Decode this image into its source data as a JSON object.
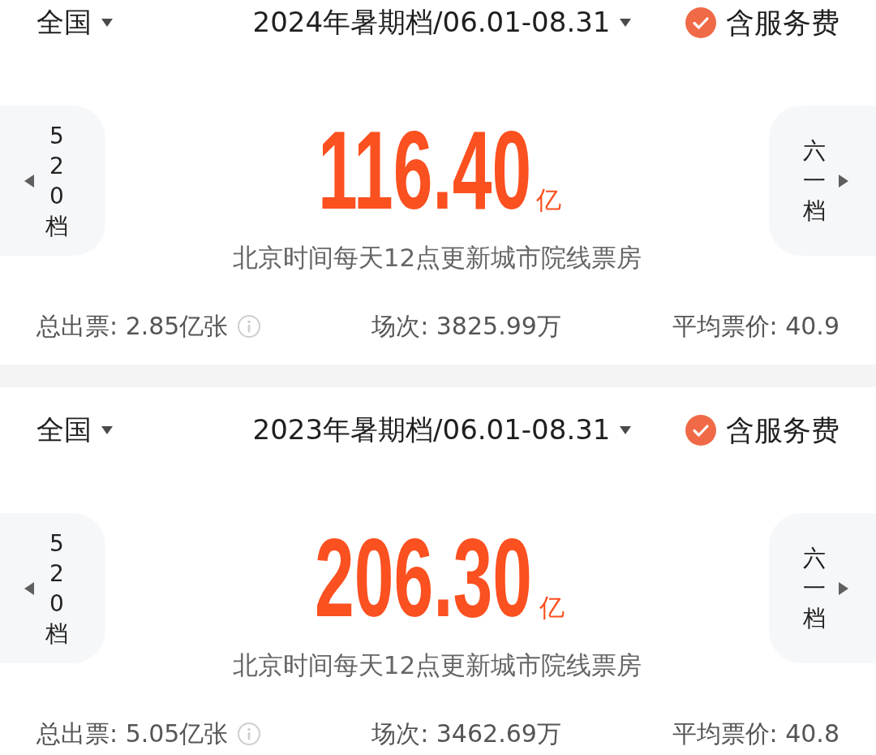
{
  "panels": [
    {
      "region": {
        "label": "全国"
      },
      "period": {
        "label": "2024年暑期档/06.01-08.31"
      },
      "service_fee": {
        "label": "含服务费",
        "checked": true
      },
      "prev_button": {
        "label": "520档"
      },
      "box_office": {
        "value": "116.40",
        "unit": "亿"
      },
      "note": "北京时间每天12点更新城市院线票房",
      "next_button": {
        "label": "六一档"
      },
      "stats": [
        {
          "kind": "info",
          "text": "总出票: 2.85亿张"
        },
        {
          "kind": "plain",
          "text": "场次: 3825.99万"
        },
        {
          "kind": "plain",
          "text": "平均票价: 40.9"
        }
      ]
    },
    {
      "region": {
        "label": "全国"
      },
      "period": {
        "label": "2023年暑期档/06.01-08.31"
      },
      "service_fee": {
        "label": "含服务费",
        "checked": true
      },
      "prev_button": {
        "label": "520档"
      },
      "box_office": {
        "value": "206.30",
        "unit": "亿"
      },
      "note": "北京时间每天12点更新城市院线票房",
      "next_button": {
        "label": "六一档"
      },
      "stats": [
        {
          "kind": "info",
          "text": "总出票: 5.05亿张"
        },
        {
          "kind": "plain",
          "text": "场次: 3462.69万"
        },
        {
          "kind": "plain",
          "text": "平均票价: 40.8"
        }
      ]
    }
  ]
}
